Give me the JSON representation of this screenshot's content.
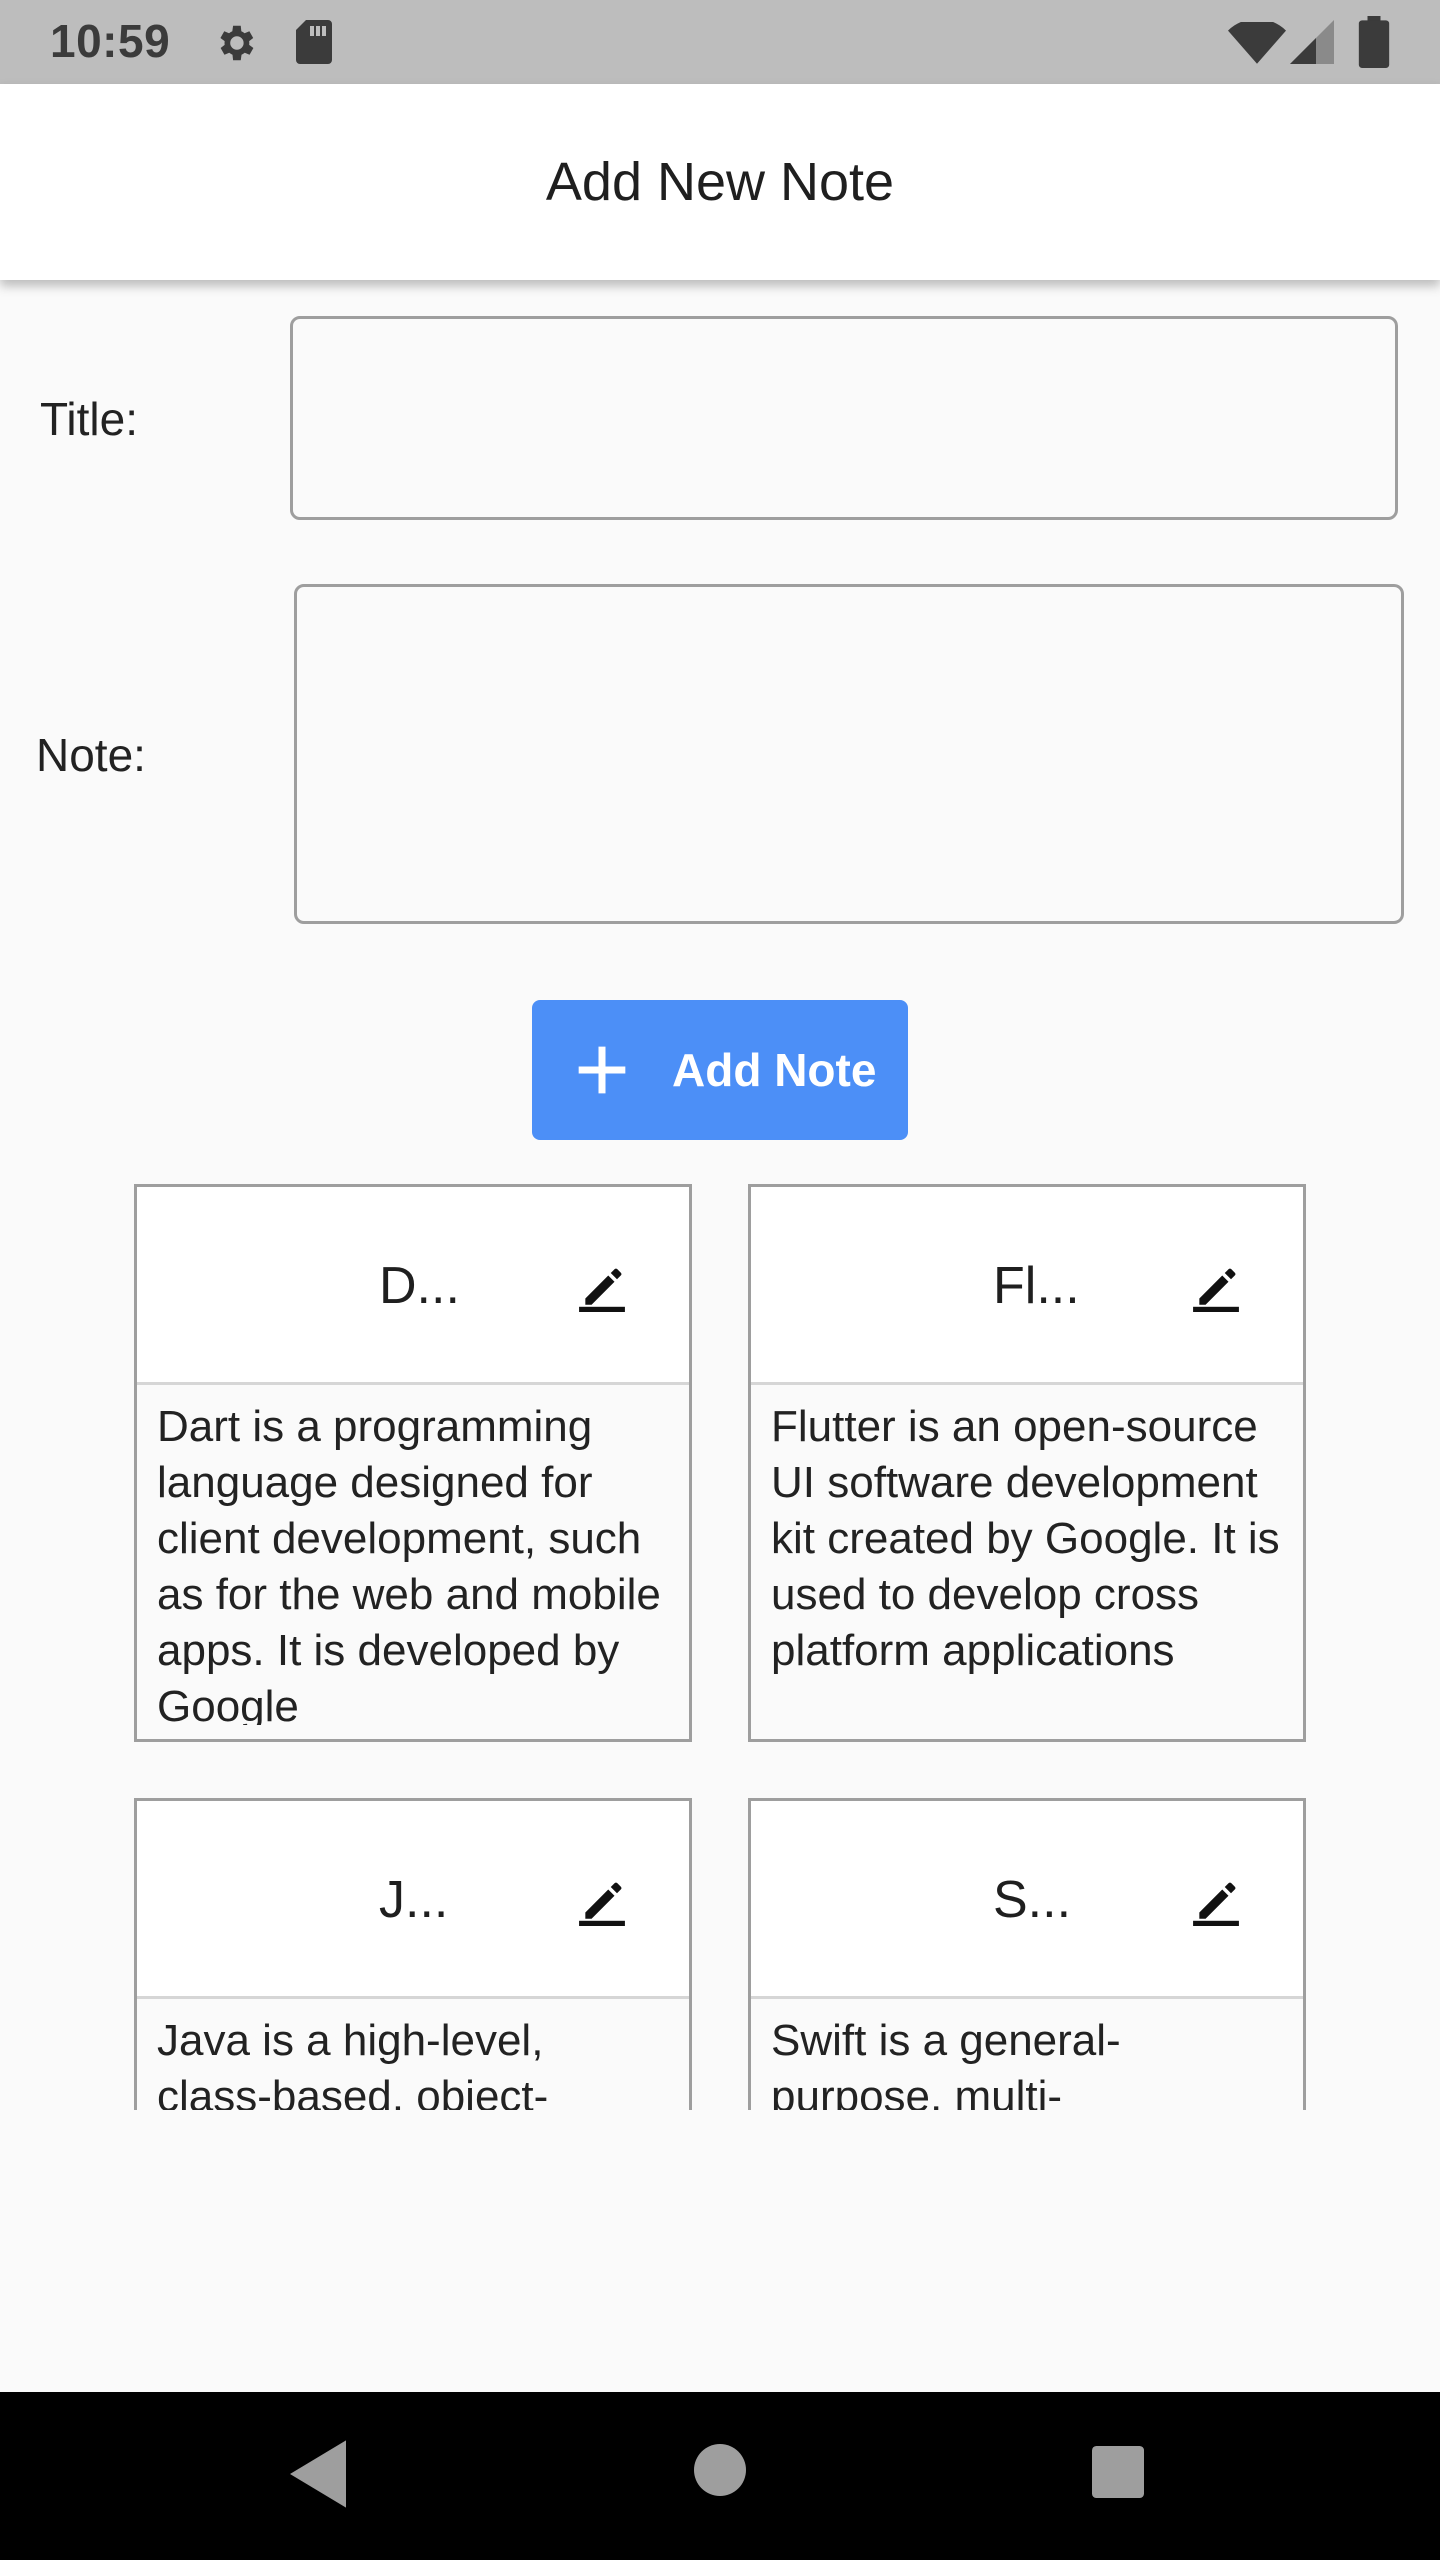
{
  "status_bar": {
    "time": "10:59",
    "icons": [
      "gear-icon",
      "sd-card-icon",
      "wifi-icon",
      "signal-icon",
      "battery-icon"
    ]
  },
  "app_bar": {
    "title": "Add New Note"
  },
  "form": {
    "title_label": "Title:",
    "title_value": "",
    "note_label": "Note:",
    "note_value": "",
    "add_button_label": "Add Note"
  },
  "notes": [
    {
      "title": "D...",
      "body": "Dart is a programming language designed for client development, such as for the web and mobile apps. It is developed by Google"
    },
    {
      "title": "Fl...",
      "body": "Flutter is an open-source UI software development kit created by Google. It is used to develop cross platform applications"
    },
    {
      "title": "J...",
      "body": "Java is a high-level, class-based, object-"
    },
    {
      "title": "S...",
      "body": "Swift is a general-purpose, multi-"
    }
  ],
  "colors": {
    "accent": "#4c8ff7",
    "status_bar": "#bdbdbd",
    "nav_bar": "#000000",
    "background": "#fafafa"
  }
}
